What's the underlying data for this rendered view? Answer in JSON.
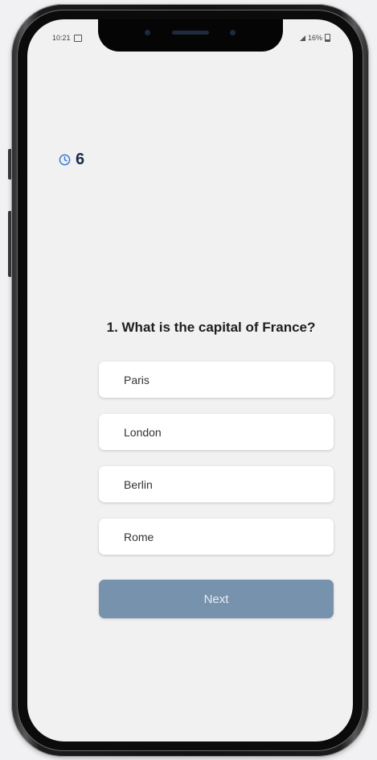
{
  "status_bar": {
    "time": "10:21",
    "battery": "16%"
  },
  "timer": {
    "value": "6",
    "icon": "clock-icon"
  },
  "question": {
    "text": "1. What is the capital of France?"
  },
  "options": [
    {
      "label": "Paris"
    },
    {
      "label": "London"
    },
    {
      "label": "Berlin"
    },
    {
      "label": "Rome"
    }
  ],
  "next_button": {
    "label": "Next",
    "enabled": false
  },
  "colors": {
    "accent": "#1b2b48",
    "timer_icon": "#3a7bd5",
    "next_button_bg": "#7792ad",
    "background": "#f1f1f2"
  }
}
